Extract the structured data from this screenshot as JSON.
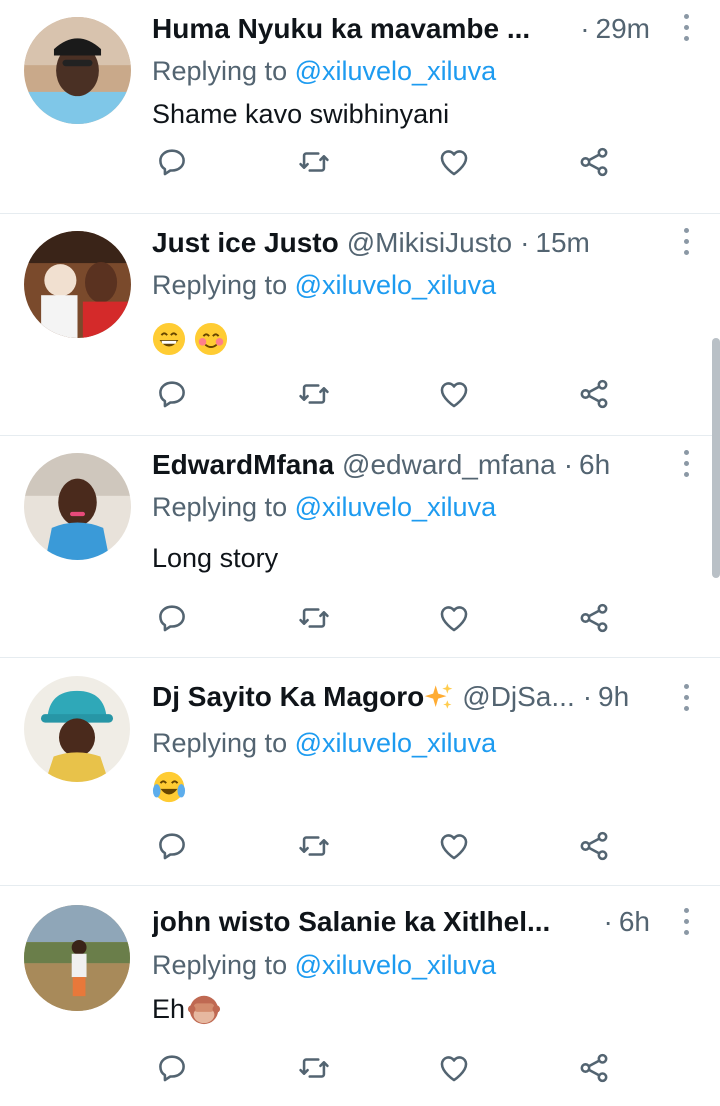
{
  "tweets": [
    {
      "name": "Huma Nyuku ka mavambe ...",
      "handle": "",
      "time": "29m",
      "reply_prefix": "Replying to ",
      "reply_to": "@xiluvelo_xiluva",
      "text": "Shame kavo swibhinyani"
    },
    {
      "name": "Just ice Justo",
      "handle": "@MikisiJusto",
      "time": "15m",
      "reply_prefix": "Replying to ",
      "reply_to": "@xiluvelo_xiluva",
      "text": "",
      "emojis": [
        "grinning-face-with-smiling-eyes",
        "smiling-face-with-rosy-cheeks"
      ]
    },
    {
      "name": "EdwardMfana",
      "handle": "@edward_mfana",
      "time": "6h",
      "reply_prefix": "Replying to ",
      "reply_to": "@xiluvelo_xiluva",
      "text": "Long story"
    },
    {
      "name": "Dj Sayito Ka Magoro",
      "name_emoji": "sparkles",
      "handle": "@DjSa...",
      "time": "9h",
      "reply_prefix": "Replying to ",
      "reply_to": "@xiluvelo_xiluva",
      "text": "",
      "emojis": [
        "face-with-tears-of-joy"
      ]
    },
    {
      "name": "john wisto Salanie ka Xitlhel...",
      "handle": "",
      "time": "6h",
      "reply_prefix": "Replying to ",
      "reply_to": "@xiluvelo_xiluva",
      "text": "Eh",
      "emojis": [
        "see-no-evil-monkey"
      ]
    }
  ],
  "separator": "·",
  "action_icons": [
    "reply-icon",
    "retweet-icon",
    "like-icon",
    "share-icon"
  ],
  "colors": {
    "link": "#1d9bf0",
    "muted": "#536471",
    "icon": "#536471",
    "divider": "#e6ecf0"
  }
}
